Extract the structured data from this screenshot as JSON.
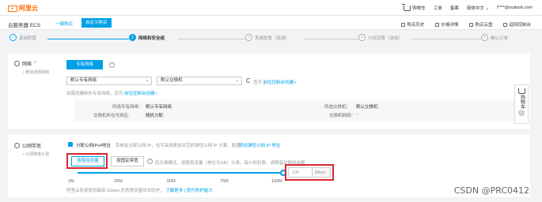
{
  "brand": {
    "name": "阿里云"
  },
  "topnav": {
    "links": [
      "购物车",
      "工单",
      "备案",
      "简体中文 ⌄"
    ],
    "email": "l****@outlook.com"
  },
  "subnav": {
    "product": "云服务器 ECS",
    "tabs": [
      "一键购买",
      "自定义购买"
    ],
    "right_links": [
      "购买历史",
      "价格详情",
      "购买云盘",
      "返回控制台"
    ]
  },
  "steps": [
    {
      "num": "✓",
      "label": "基础配置",
      "state": "done"
    },
    {
      "num": "2",
      "label": "网络和安全组",
      "state": "active"
    },
    {
      "num": "3",
      "label": "系统配置（选填）",
      "state": "todo"
    },
    {
      "num": "4",
      "label": "分组设置（选填）",
      "state": "todo"
    },
    {
      "num": "5",
      "label": "确认订单",
      "state": "todo"
    }
  ],
  "network": {
    "title": "网络",
    "required": "*",
    "subtitle": "• 教我选择网络",
    "type_button": "专有网络",
    "vpc_select": "默认专有网络",
    "vswitch_select": "默认交换机",
    "console_link_prefix": "您可",
    "console_link": "前往控制台创建>",
    "hint_prefix": "如需创建新的专有网络，您可",
    "hint_link": "前往控制台创建>",
    "vpc_label": "所选专有网络：",
    "vpc_value": "默认专有网络",
    "zone_label": "交换机所在可用区：",
    "zone_value": "随机分配",
    "vswitch_label": "所选交换机：",
    "vswitch_value": "默认交换机",
    "vswitch_ip_label": "交换机网段：",
    "vswitch_ip_value": "-"
  },
  "bandwidth": {
    "title": "公网带宽",
    "subtitle": "• 公网带宽计费",
    "checkbox_label": "分配公网IPv4地址",
    "checkbox_desc": "系统会分配公网 IP，也可采用更加灵活的弹性公网 IP 方案，配置",
    "checkbox_link": "将经弹性公网 IP 地址",
    "btn_by_bandwidth": "按使用流量",
    "btn_by_traffic": "按固定带宽",
    "traffic_desc": "后付费模式，按使用流量（单位为GB）计费，每小时扣费。请预留足够的余额",
    "ticks": [
      "1M",
      "25M",
      "50M",
      "75M",
      "100M"
    ],
    "value": "100",
    "unit": "Mbps",
    "selected_mbps": 100,
    "note_prefix": "阿里云免费提供最高 5Gbps 的恶意流量攻击防护，",
    "note_link": "了解更多 | 提升防护能力"
  },
  "side_cart": {
    "label": "购物车",
    "count": "0"
  },
  "watermark": "CSDN @PRC0412"
}
